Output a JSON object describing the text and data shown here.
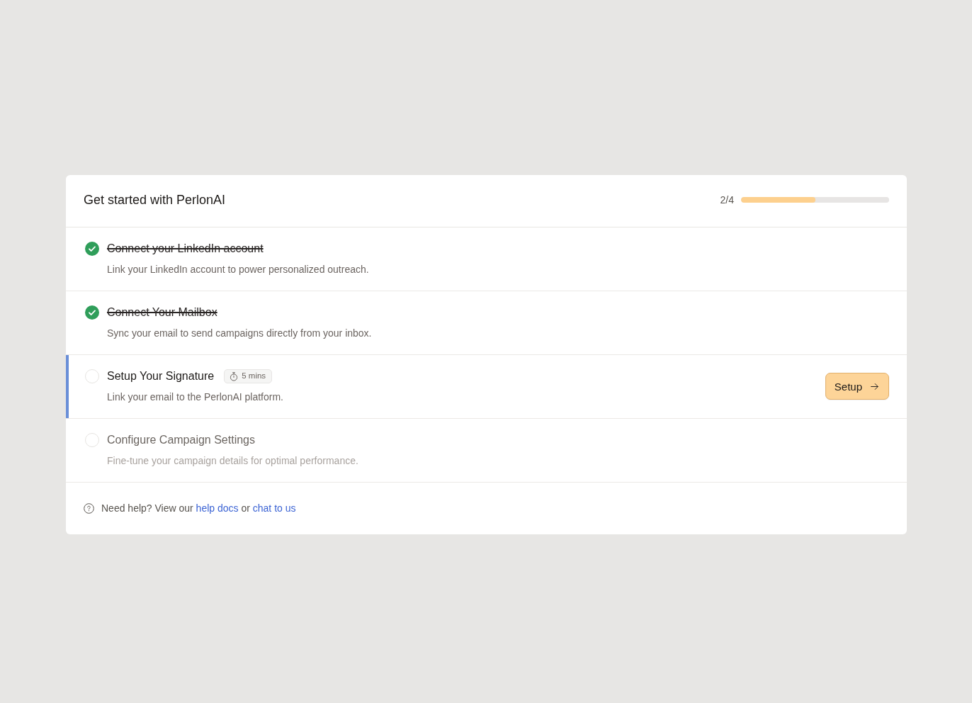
{
  "header": {
    "title": "Get started with PerlonAI",
    "progress": {
      "reading": "2/4",
      "level": 0.5
    }
  },
  "steps": [
    {
      "title": "Connect your LinkedIn account",
      "description": "Link your LinkedIn account to power personalized outreach.",
      "completed": true,
      "selected": false,
      "disabled": false
    },
    {
      "title": "Connect Your Mailbox",
      "description": "Sync your email to send campaigns directly from your inbox.",
      "completed": true,
      "selected": false,
      "disabled": false
    },
    {
      "title": "Setup Your Signature",
      "duration": "5 mins",
      "description": "Link your email to the PerlonAI platform.",
      "completed": false,
      "selected": true,
      "disabled": false,
      "action": "Setup"
    },
    {
      "title": "Configure Campaign Settings",
      "description": "Fine-tune your campaign details for optimal performance.",
      "completed": false,
      "selected": false,
      "disabled": true
    }
  ],
  "help": {
    "parts": [
      {
        "kind": "text",
        "text": "Need help? View our"
      },
      {
        "kind": "link",
        "text": "help docs"
      },
      {
        "kind": "text",
        "text": "or"
      },
      {
        "kind": "link",
        "text": "chat to us"
      }
    ]
  }
}
